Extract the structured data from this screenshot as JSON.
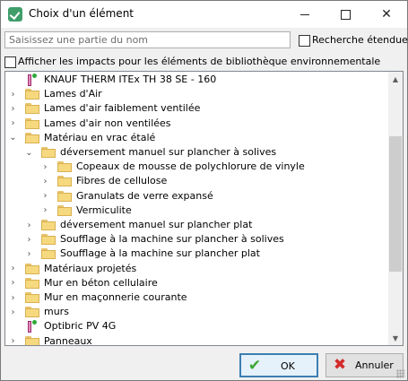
{
  "window": {
    "title": "Choix d'un élément"
  },
  "titlebar": {
    "minimize_icon": "minimize-icon",
    "maximize_icon": "maximize-icon",
    "close_glyph": "✕"
  },
  "search": {
    "placeholder": "Saisissez une partie du nom",
    "value": ""
  },
  "extended_search": {
    "label": "Recherche étendue",
    "checked": false
  },
  "env_impacts": {
    "label": "Afficher les impacts pour les éléments de bibliothèque environnementale",
    "checked": false
  },
  "tree": {
    "items": [
      {
        "label": "KNAUF THERM ITEx TH 38 SE - 160",
        "kind": "product",
        "level": 0,
        "expander": ""
      },
      {
        "label": "Lames d'Air",
        "kind": "folder",
        "level": 0,
        "expander": "›"
      },
      {
        "label": "Lames d'air faiblement ventilée",
        "kind": "folder",
        "level": 0,
        "expander": "›"
      },
      {
        "label": "Lames d'air non ventilées",
        "kind": "folder",
        "level": 0,
        "expander": "›"
      },
      {
        "label": "Matériau en vrac étalé",
        "kind": "folder",
        "level": 0,
        "expander": "⌄"
      },
      {
        "label": "déversement manuel sur plancher à solives",
        "kind": "folder",
        "level": 1,
        "expander": "⌄"
      },
      {
        "label": "Copeaux de mousse de polychlorure de vinyle",
        "kind": "folder",
        "level": 2,
        "expander": "›"
      },
      {
        "label": "Fibres de cellulose",
        "kind": "folder",
        "level": 2,
        "expander": "›"
      },
      {
        "label": "Granulats de verre expansé",
        "kind": "folder",
        "level": 2,
        "expander": "›"
      },
      {
        "label": "Vermiculite",
        "kind": "folder",
        "level": 2,
        "expander": "›"
      },
      {
        "label": "déversement manuel sur plancher plat",
        "kind": "folder",
        "level": 1,
        "expander": "›"
      },
      {
        "label": "Soufflage à la machine sur plancher à solives",
        "kind": "folder",
        "level": 1,
        "expander": "›"
      },
      {
        "label": "Soufflage à la machine sur plancher plat",
        "kind": "folder",
        "level": 1,
        "expander": "›"
      },
      {
        "label": "Matériaux projetés",
        "kind": "folder",
        "level": 0,
        "expander": "›"
      },
      {
        "label": "Mur en béton cellulaire",
        "kind": "folder",
        "level": 0,
        "expander": "›"
      },
      {
        "label": "Mur en maçonnerie courante",
        "kind": "folder",
        "level": 0,
        "expander": "›"
      },
      {
        "label": "murs",
        "kind": "folder",
        "level": 0,
        "expander": "›"
      },
      {
        "label": "Optibric PV 4G",
        "kind": "product",
        "level": 0,
        "expander": ""
      },
      {
        "label": "Panneaux",
        "kind": "folder",
        "level": 0,
        "expander": "›"
      }
    ]
  },
  "buttons": {
    "ok": "OK",
    "cancel": "Annuler"
  }
}
